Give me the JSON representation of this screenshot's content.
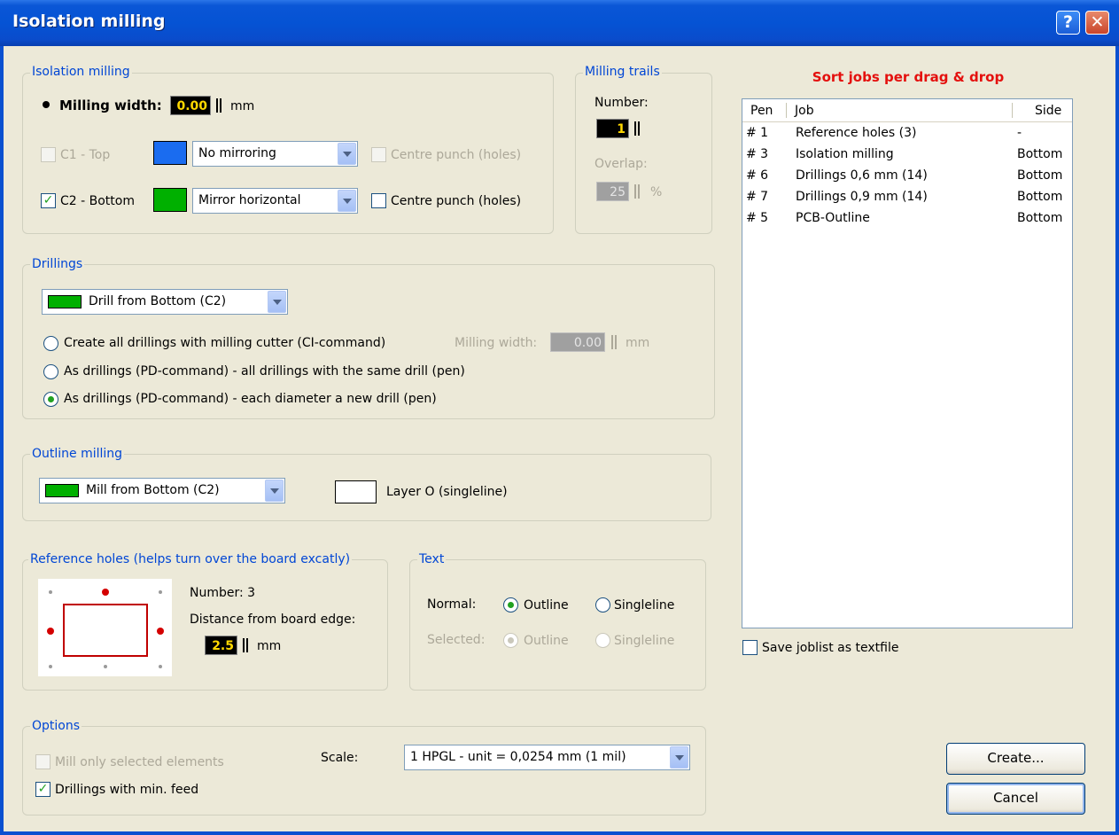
{
  "window": {
    "title": "Isolation milling",
    "help_glyph": "?",
    "close_glyph": "✕"
  },
  "isolation": {
    "label": "Isolation milling",
    "milling_width_label": "Milling width:",
    "milling_width_value": "0.00",
    "unit_mm": "mm",
    "c1": {
      "label": "C1 - Top",
      "checked": false,
      "enabled": false,
      "color": "#1a6cf0",
      "mirror": "No mirroring",
      "centre_punch": "Centre punch (holes)",
      "centre_checked": false
    },
    "c2": {
      "label": "C2 - Bottom",
      "checked": true,
      "enabled": true,
      "color": "#00b000",
      "mirror": "Mirror horizontal",
      "centre_punch": "Centre punch (holes)",
      "centre_checked": false
    }
  },
  "trails": {
    "label": "Milling trails",
    "number_label": "Number:",
    "number_value": "1",
    "overlap_label": "Overlap:",
    "overlap_value": "25",
    "overlap_unit": "%"
  },
  "drillings": {
    "label": "Drillings",
    "side": "Drill from Bottom (C2)",
    "options": [
      "Create all drillings with milling cutter (CI-command)",
      "As drillings (PD-command) - all drillings with the same drill (pen)",
      "As drillings (PD-command) - each diameter a new drill (pen)"
    ],
    "selected_index": 2,
    "milling_width_label": "Milling width:",
    "milling_width_value": "0.00",
    "unit_mm": "mm"
  },
  "outline": {
    "label": "Outline milling",
    "side": "Mill from Bottom (C2)",
    "layer": "Layer O (singleline)"
  },
  "reference": {
    "label": "Reference holes (helps turn over the board excatly)",
    "number_label": "Number: 3",
    "distance_label": "Distance from board edge:",
    "distance_value": "2.5",
    "unit_mm": "mm"
  },
  "text": {
    "label": "Text",
    "normal_label": "Normal:",
    "selected_label": "Selected:",
    "outline": "Outline",
    "singleline": "Singleline",
    "normal_choice": "Outline",
    "selected_choice": "Outline"
  },
  "options": {
    "label": "Options",
    "mill_selected": "Mill only selected elements",
    "mill_selected_checked": false,
    "drill_min_feed": "Drillings with min. feed",
    "drill_min_feed_checked": true,
    "scale_label": "Scale:",
    "scale_value": "1 HPGL - unit = 0,0254 mm (1 mil)"
  },
  "jobs": {
    "heading": "Sort jobs per drag & drop",
    "columns": [
      "Pen",
      "Job",
      "Side"
    ],
    "rows": [
      {
        "pen": "# 1",
        "job": "Reference holes (3)",
        "side": "-"
      },
      {
        "pen": "# 3",
        "job": "Isolation milling",
        "side": "Bottom"
      },
      {
        "pen": "# 6",
        "job": "Drillings 0,6 mm (14)",
        "side": "Bottom"
      },
      {
        "pen": "# 7",
        "job": "Drillings 0,9 mm (14)",
        "side": "Bottom"
      },
      {
        "pen": "# 5",
        "job": "PCB-Outline",
        "side": "Bottom"
      }
    ],
    "save_label": "Save joblist as textfile",
    "save_checked": false
  },
  "buttons": {
    "create": "Create...",
    "cancel": "Cancel"
  },
  "check_glyph": "✓"
}
